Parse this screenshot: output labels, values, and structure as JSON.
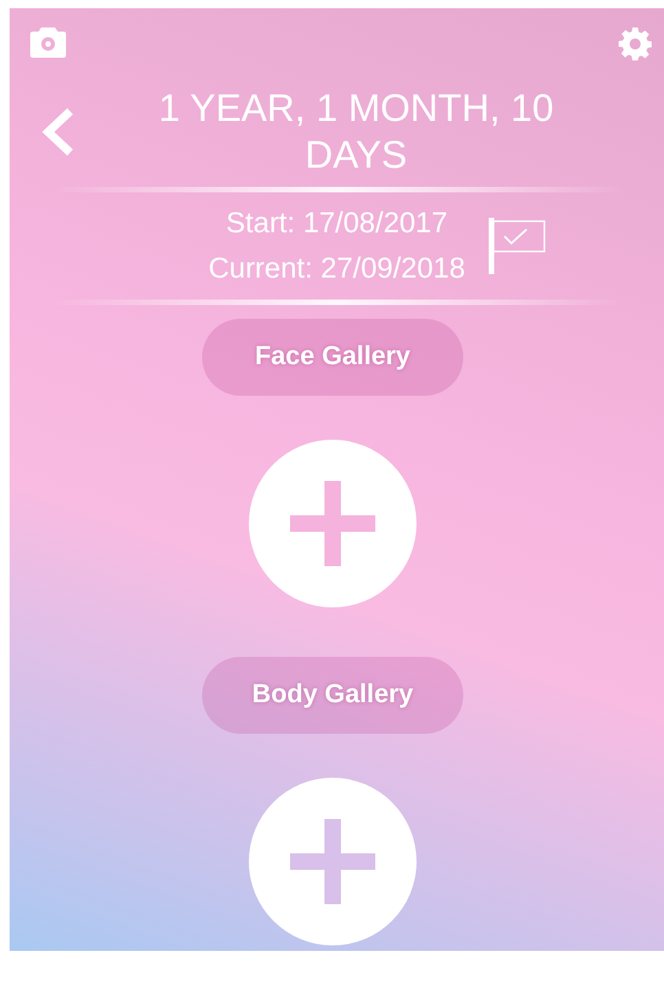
{
  "header": {
    "title": "1 YEAR, 1 MONTH, 10 DAYS",
    "start": "Start: 17/08/2017",
    "current": "Current: 27/09/2018"
  },
  "galleries": [
    {
      "label": "Face Gallery"
    },
    {
      "label": "Body Gallery"
    }
  ]
}
